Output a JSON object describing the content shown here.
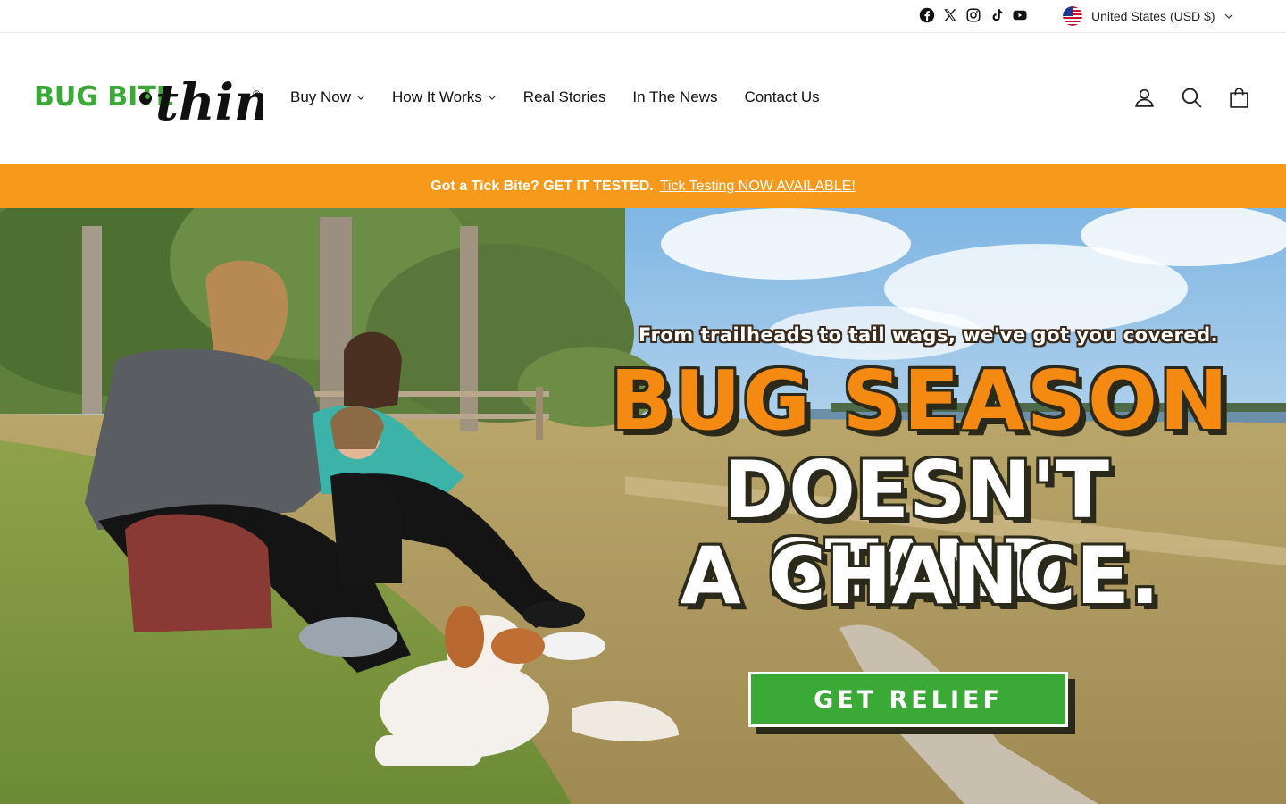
{
  "social": {
    "items": [
      "facebook-icon",
      "x-icon",
      "instagram-icon",
      "tiktok-icon",
      "youtube-icon"
    ]
  },
  "locale": {
    "label": "United States (USD $)"
  },
  "logo": {
    "text_left": "BUG BITE",
    "text_right": "thing",
    "mark": "®",
    "color_green": "#3aa935"
  },
  "nav": {
    "items": [
      {
        "label": "Buy Now",
        "has_dropdown": true
      },
      {
        "label": "How It Works",
        "has_dropdown": true
      },
      {
        "label": "Real Stories",
        "has_dropdown": false
      },
      {
        "label": "In The News",
        "has_dropdown": false
      },
      {
        "label": "Contact Us",
        "has_dropdown": false
      }
    ]
  },
  "header_icons": [
    "account-icon",
    "search-icon",
    "cart-icon"
  ],
  "announcement": {
    "bold": "Got a Tick Bite? GET IT TESTED.",
    "link": "Tick Testing NOW AVAILABLE!",
    "bg_color": "#f79a1b"
  },
  "hero": {
    "tagline": "From trailheads to tail wags, we've got you covered.",
    "line1": "BUG SEASON",
    "line2": "DOESN'T STAND",
    "line3": "A CHANCE.",
    "cta": "GET RELIEF",
    "cta_color": "#3aa935",
    "accent_orange": "#f58a12"
  }
}
